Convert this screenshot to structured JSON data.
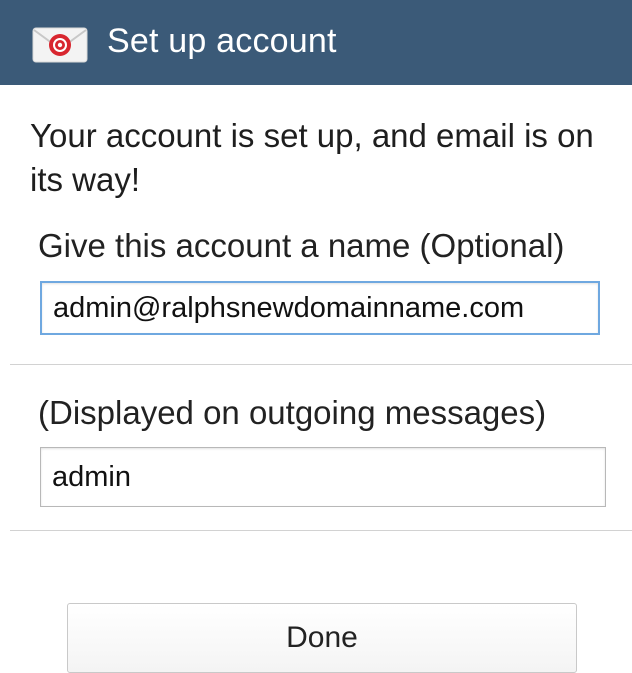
{
  "header": {
    "title": "Set up account",
    "icon": "email-app-icon",
    "background_color": "#3b5a78"
  },
  "message": "Your account is set up, and email is on its way!",
  "account_name": {
    "label": "Give this account a name (Optional)",
    "value": "admin@ralphsnewdomainname.com"
  },
  "display_name": {
    "label": "(Displayed on outgoing messages)",
    "value": "admin"
  },
  "actions": {
    "done_label": "Done"
  }
}
